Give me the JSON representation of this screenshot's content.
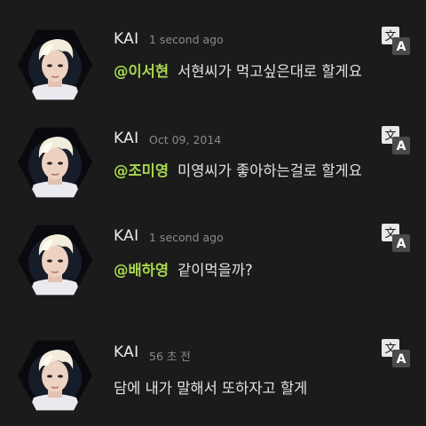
{
  "comments": [
    {
      "author": "KAI",
      "timestamp": "1 second ago",
      "mention": "@이서현",
      "text": "서현씨가 먹고싶은대로 할게요",
      "translate_icon": "translate-icon"
    },
    {
      "author": "KAI",
      "timestamp": "Oct 09, 2014",
      "mention": "@조미영",
      "text": "미영씨가 좋아하는걸로 할게요",
      "translate_icon": "translate-icon"
    },
    {
      "author": "KAI",
      "timestamp": "1 second ago",
      "mention": "@배하영",
      "text": "같이먹을까?",
      "translate_icon": "translate-icon"
    },
    {
      "author": "KAI",
      "timestamp": "56 초 전",
      "mention": "",
      "text": "담에 내가 말해서 또하자고 할게",
      "translate_icon": "translate-icon"
    }
  ],
  "colors": {
    "background": "#1b1b1b",
    "mention": "#a8d84e",
    "timestamp": "#8a8a8a"
  }
}
